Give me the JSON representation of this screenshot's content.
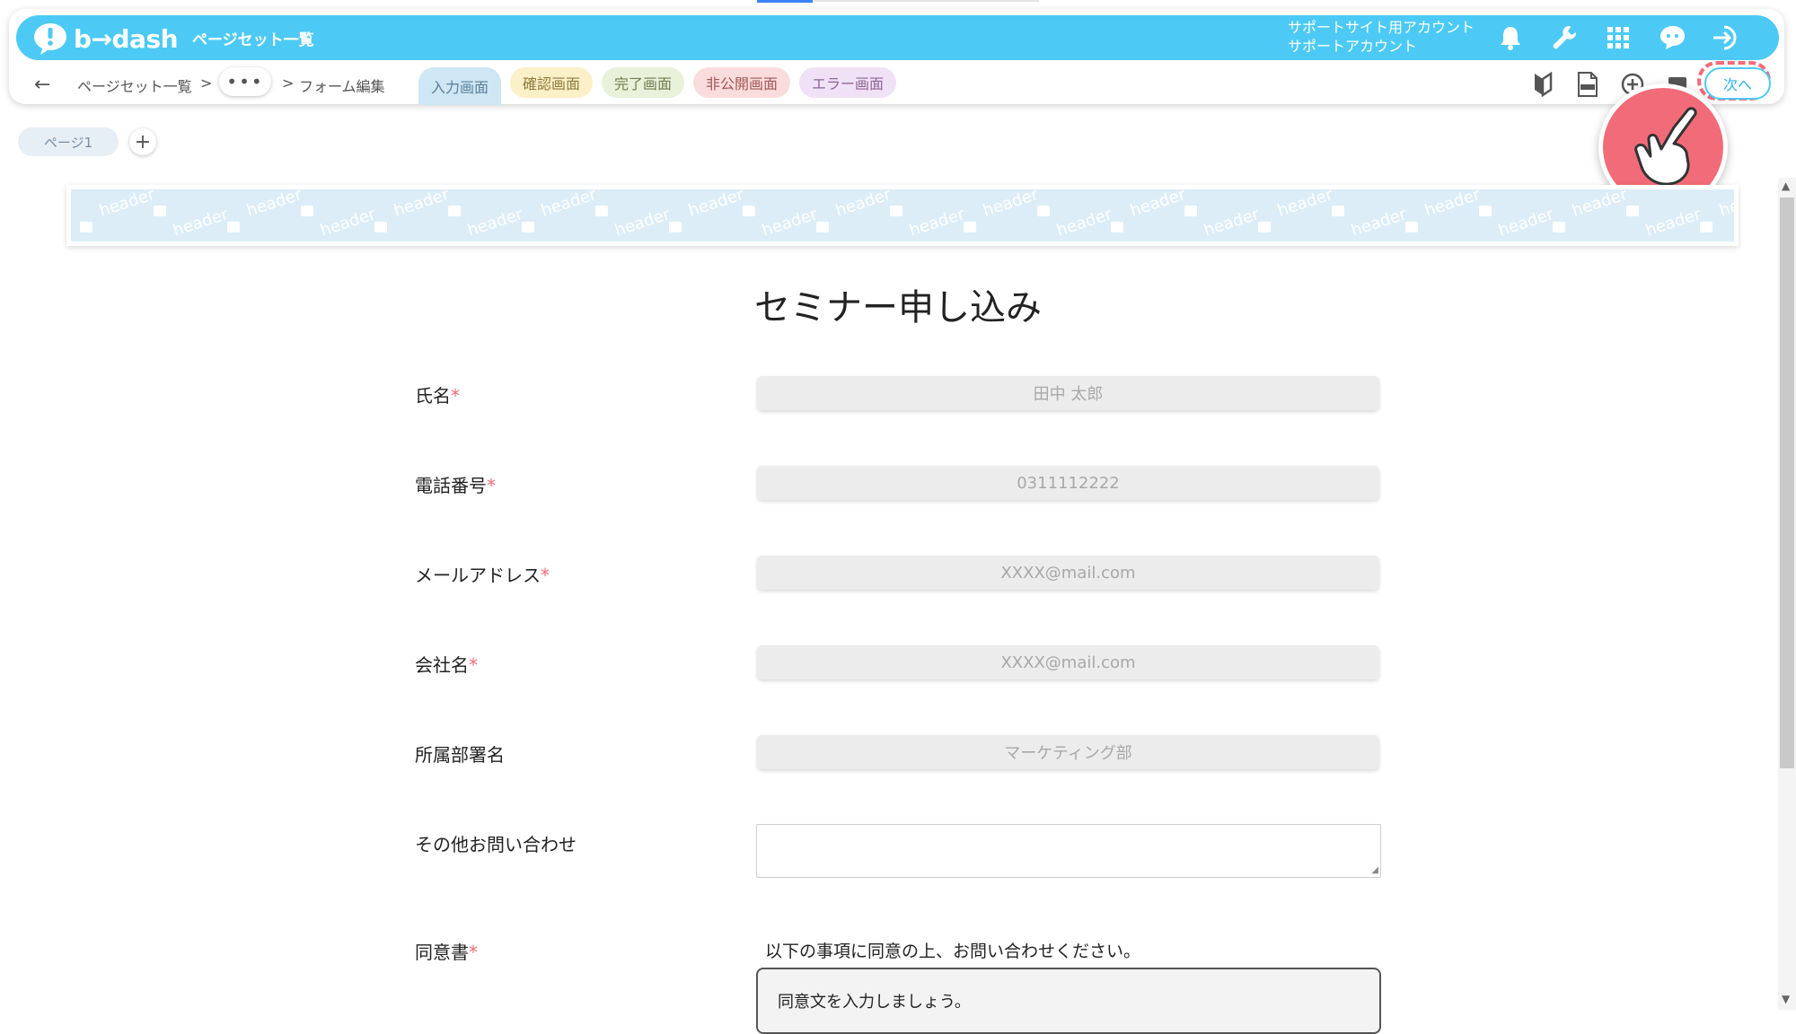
{
  "app": {
    "brand": "b→dash",
    "title": "ページセット一覧",
    "account_line1": "サポートサイト用アカウント",
    "account_line2": "サポートアカウント",
    "brand_color": "#4ccaf5"
  },
  "header_icons": [
    "bell-icon",
    "wrench-icon",
    "grid-icon",
    "support-chat-icon",
    "logout-icon"
  ],
  "breadcrumb": {
    "back": "←",
    "item1": "ページセット一覧",
    "sep": ">",
    "dots": "•••",
    "item2": "フォーム編集"
  },
  "screen_tabs": [
    {
      "label": "入力画面",
      "bg": "#cfe7f5",
      "color": "#5a7f99"
    },
    {
      "label": "確認画面",
      "bg": "#fbf0c8",
      "color": "#8d7a3a"
    },
    {
      "label": "完了画面",
      "bg": "#e8f1d9",
      "color": "#6c7f4e"
    },
    {
      "label": "非公開画面",
      "bg": "#fbdcdc",
      "color": "#a05858"
    },
    {
      "label": "エラー画面",
      "bg": "#f1e1f6",
      "color": "#8a6596"
    }
  ],
  "toolbar": {
    "icons": [
      "beginner-mark-icon",
      "html-file-icon",
      "zoom-in-icon",
      "preview-icon"
    ],
    "next_label": "次へ"
  },
  "pages": {
    "tab1": "ページ1",
    "add": "+"
  },
  "banner": {
    "text": "header"
  },
  "form": {
    "title": "セミナー申し込み",
    "required_mark": "*",
    "fields": [
      {
        "label": "氏名",
        "required": true,
        "placeholder": "田中 太郎"
      },
      {
        "label": "電話番号",
        "required": true,
        "placeholder": "0311112222"
      },
      {
        "label": "メールアドレス",
        "required": true,
        "placeholder": "XXXX@mail.com"
      },
      {
        "label": "会社名",
        "required": true,
        "placeholder": "XXXX@mail.com"
      },
      {
        "label": "所属部署名",
        "required": false,
        "placeholder": "マーケティング部"
      }
    ],
    "inquiry_label": "その他お問い合わせ",
    "consent_label": "同意書",
    "consent_intro": "以下の事項に同意の上、お問い合わせください。",
    "consent_body": "同意文を入力しましょう。"
  }
}
